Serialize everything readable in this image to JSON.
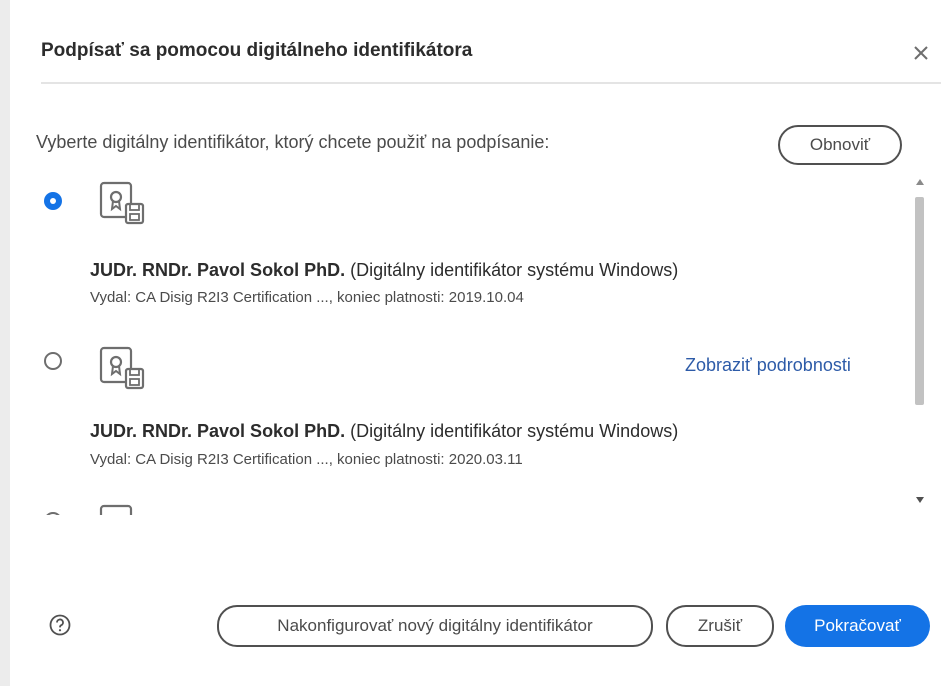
{
  "dialog": {
    "title": "Podpísať sa pomocou digitálneho identifikátora",
    "instruction": "Vyberte digitálny identifikátor, ktorý chcete použiť na podpísanie:",
    "refresh_label": "Obnoviť"
  },
  "identities": [
    {
      "selected": true,
      "name": "JUDr. RNDr. Pavol Sokol PhD.",
      "type": "(Digitálny identifikátor systému Windows)",
      "issuer": "Vydal: CA Disig R2I3 Certification ..., koniec platnosti: 2019.10.04"
    },
    {
      "selected": false,
      "name": "JUDr. RNDr. Pavol Sokol PhD.",
      "type": "(Digitálny identifikátor systému Windows)",
      "issuer": "Vydal: CA Disig R2I3 Certification ..., koniec platnosti: 2020.03.11",
      "details_link": "Zobraziť podrobnosti"
    }
  ],
  "footer": {
    "configure_label": "Nakonfigurovať nový digitálny identifikátor",
    "cancel_label": "Zrušiť",
    "continue_label": "Pokračovať"
  },
  "colors": {
    "accent": "#1473e6",
    "link": "#2d5ba8"
  },
  "icons": {
    "close": "close-icon",
    "certificate": "certificate-icon",
    "help": "help-icon",
    "scroll_up": "scroll-up-icon",
    "scroll_down": "scroll-down-icon"
  }
}
